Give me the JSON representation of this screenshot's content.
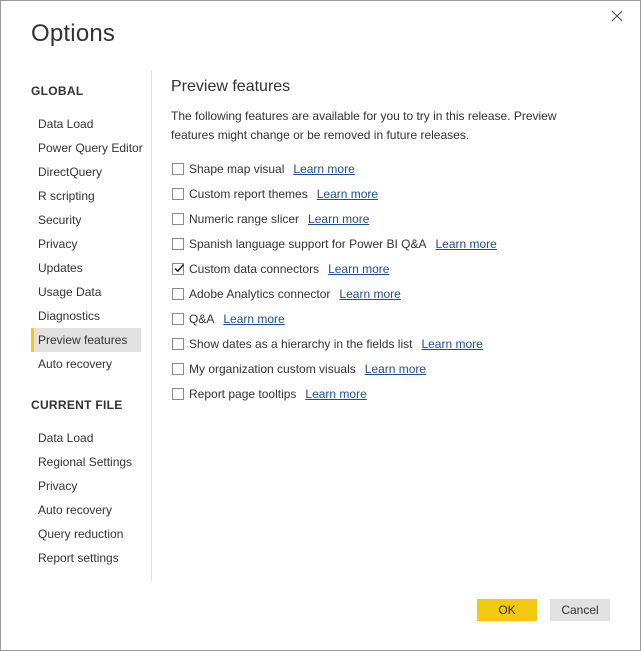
{
  "dialog": {
    "title": "Options",
    "close_icon": "close-icon"
  },
  "sidebar": {
    "global_header": "GLOBAL",
    "global_items": [
      {
        "label": "Data Load"
      },
      {
        "label": "Power Query Editor"
      },
      {
        "label": "DirectQuery"
      },
      {
        "label": "R scripting"
      },
      {
        "label": "Security"
      },
      {
        "label": "Privacy"
      },
      {
        "label": "Updates"
      },
      {
        "label": "Usage Data"
      },
      {
        "label": "Diagnostics"
      },
      {
        "label": "Preview features",
        "selected": true
      },
      {
        "label": "Auto recovery"
      }
    ],
    "current_header": "CURRENT FILE",
    "current_items": [
      {
        "label": "Data Load"
      },
      {
        "label": "Regional Settings"
      },
      {
        "label": "Privacy"
      },
      {
        "label": "Auto recovery"
      },
      {
        "label": "Query reduction"
      },
      {
        "label": "Report settings"
      }
    ]
  },
  "content": {
    "title": "Preview features",
    "description": "The following features are available for you to try in this release. Preview features might change or be removed in future releases.",
    "learn_more_label": "Learn more",
    "features": [
      {
        "label": "Shape map visual",
        "checked": false
      },
      {
        "label": "Custom report themes",
        "checked": false
      },
      {
        "label": "Numeric range slicer",
        "checked": false
      },
      {
        "label": "Spanish language support for Power BI Q&A",
        "checked": false
      },
      {
        "label": "Custom data connectors",
        "checked": true
      },
      {
        "label": "Adobe Analytics connector",
        "checked": false
      },
      {
        "label": "Q&A",
        "checked": false
      },
      {
        "label": "Show dates as a hierarchy in the fields list",
        "checked": false
      },
      {
        "label": "My organization custom visuals",
        "checked": false
      },
      {
        "label": "Report page tooltips",
        "checked": false
      }
    ]
  },
  "footer": {
    "ok_label": "OK",
    "cancel_label": "Cancel"
  },
  "colors": {
    "accent": "#f2c811",
    "link": "#1e4e9a",
    "selected_bg": "#e1e1e1",
    "text": "#333333"
  }
}
